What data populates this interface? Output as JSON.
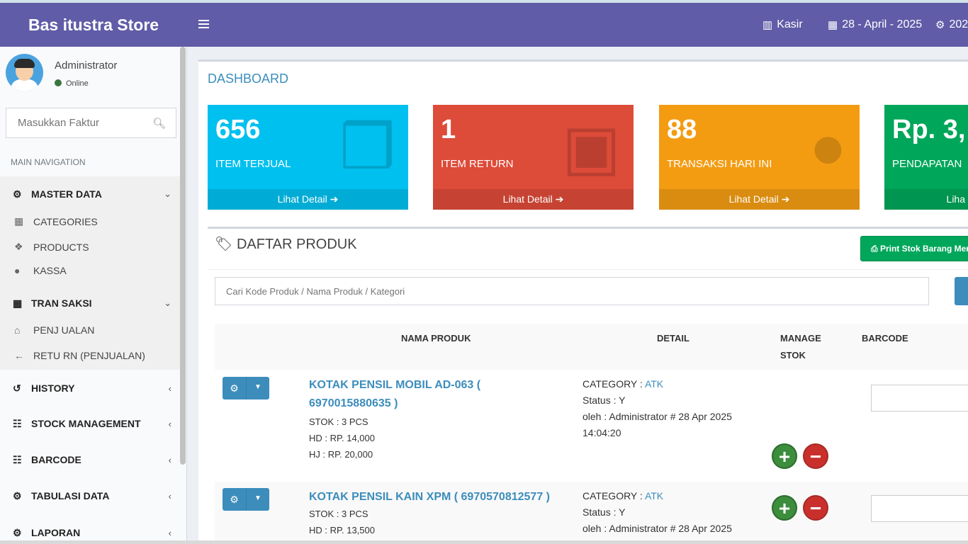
{
  "header": {
    "brand": "Bas itustra Store",
    "menu_icon": "hamburger-icon",
    "kasir_label": "Kasir",
    "date_label": "28 - April - 2025",
    "settings_label": "202"
  },
  "sidebar": {
    "user_name": "Administrator",
    "user_status": "Online",
    "search_placeholder": "Masukkan Faktur",
    "nav_header": "MAIN NAVIGATION",
    "master_data": "MASTER DATA",
    "categories": "CATEGORIES",
    "products": "PRODUCTS",
    "kassa": "KASSA",
    "transaksi": "TRAN SAKSI",
    "penjualan": "PENJ UALAN",
    "return_penjualan": "RETU RN (PENJUALAN)",
    "history": "HISTORY",
    "stock_management": "STOCK MANAGEMENT",
    "barcode": "BARCODE",
    "tabulasi_data": "TABULASI DATA",
    "laporan": "LAPORAN"
  },
  "dashboard": {
    "title": "DASHBOARD",
    "boxes": [
      {
        "value": "656",
        "label": "ITEM TERJUAL",
        "link": "Lihat Detail",
        "color": "#00c0ef",
        "icon": "cubes-icon"
      },
      {
        "value": "1",
        "label": "ITEM RETURN",
        "link": "Lihat Detail",
        "color": "#dd4b39",
        "icon": "money-icon"
      },
      {
        "value": "88",
        "label": "TRANSAKSI HARI INI",
        "link": "Lihat Detail",
        "color": "#f39c12",
        "icon": "users-icon"
      },
      {
        "value": "Rp. 3,",
        "label": "PENDAPATAN",
        "link": "Liha",
        "color": "#00a65a",
        "icon": "money-icon"
      }
    ]
  },
  "products": {
    "title": "DAFTAR PRODUK",
    "print_button": "Print Stok Barang Mer",
    "search_placeholder": "Cari Kode Produk / Nama Produk / Kategori",
    "columns": {
      "name": "NAMA PRODUK",
      "detail": "DETAIL",
      "manage_stok": "MANAGE STOK",
      "barcode": "BARCODE"
    },
    "rows": [
      {
        "name": "KOTAK PENSIL MOBIL AD-063 ( 6970015880635 )",
        "stok": "STOK : 3 PCS",
        "hd": "HD : RP. 14,000",
        "hj": "HJ : RP. 20,000",
        "category_label": "CATEGORY :",
        "category": "ATK",
        "status": "Status : Y",
        "oleh": "oleh : Administrator # 28 Apr 2025 14:04:20"
      },
      {
        "name": "KOTAK PENSIL KAIN XPM ( 6970570812577 )",
        "stok": "STOK : 3 PCS",
        "hd": "HD : RP. 13,500",
        "hj": "",
        "category_label": "CATEGORY :",
        "category": "ATK",
        "status": "Status : Y",
        "oleh": "oleh : Administrator # 28 Apr 2025"
      }
    ]
  }
}
